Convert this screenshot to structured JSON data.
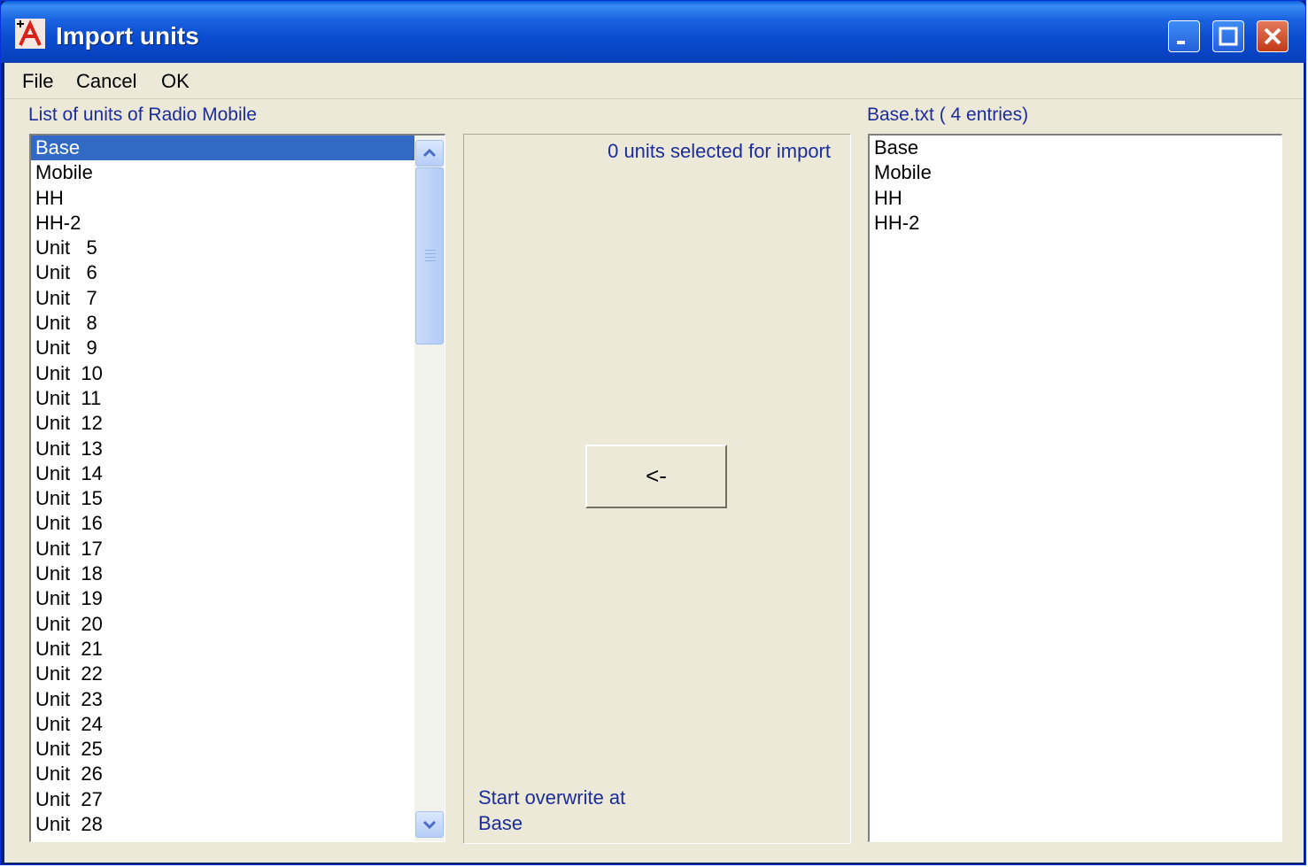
{
  "window": {
    "title": "Import units"
  },
  "menu": [
    "File",
    "Cancel",
    "OK"
  ],
  "left_panel": {
    "header": "List of units of Radio Mobile",
    "items": [
      "Base",
      "Mobile",
      "HH",
      "HH-2",
      "Unit   5",
      "Unit   6",
      "Unit   7",
      "Unit   8",
      "Unit   9",
      "Unit  10",
      "Unit  11",
      "Unit  12",
      "Unit  13",
      "Unit  14",
      "Unit  15",
      "Unit  16",
      "Unit  17",
      "Unit  18",
      "Unit  19",
      "Unit  20",
      "Unit  21",
      "Unit  22",
      "Unit  23",
      "Unit  24",
      "Unit  25",
      "Unit  26",
      "Unit  27",
      "Unit  28"
    ],
    "selected_index": 0
  },
  "middle_panel": {
    "status": "0 units selected for import",
    "import_button": "<-",
    "overwrite_label": "Start overwrite at",
    "overwrite_value": "Base"
  },
  "right_panel": {
    "header": "Base.txt ( 4 entries)",
    "items": [
      "Base",
      "Mobile",
      "HH",
      "HH-2"
    ]
  },
  "colors": {
    "title_bar": "#0a4cd0",
    "selection": "#316ac5",
    "label_blue": "#1c2d9a",
    "face": "#ece9d8"
  }
}
